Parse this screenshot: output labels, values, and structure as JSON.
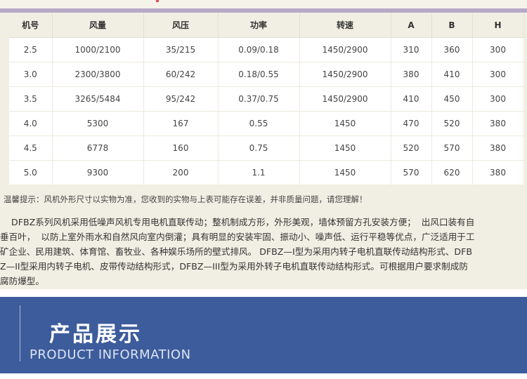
{
  "table": {
    "headers": [
      "机号",
      "风量",
      "风压",
      "功率",
      "转速",
      "A",
      "B",
      "H"
    ],
    "rows": [
      [
        "2.5",
        "1000/2100",
        "35/215",
        "0.09/0.18",
        "1450/2900",
        "310",
        "360",
        "300"
      ],
      [
        "3.0",
        "2300/3800",
        "60/242",
        "0.18/0.55",
        "1450/2900",
        "380",
        "410",
        "300"
      ],
      [
        "3.5",
        "3265/5484",
        "95/242",
        "0.37/0.75",
        "1450/2900",
        "410",
        "450",
        "300"
      ],
      [
        "4.0",
        "5300",
        "167",
        "0.55",
        "1450",
        "470",
        "520",
        "380"
      ],
      [
        "4.5",
        "6778",
        "160",
        "0.75",
        "1450",
        "520",
        "570",
        "380"
      ],
      [
        "5.0",
        "9300",
        "200",
        "1.1",
        "1450",
        "570",
        "620",
        "380"
      ]
    ]
  },
  "notice": "温馨提示：风机外形尺寸以实物为准，您收到的实物与上表可能存在误差，并非质量问题，请您理解！",
  "description_lines": [
    "    DFBZ系列风机采用低噪声风机专用电机直联传动；整机制成方形，外形美观，墙体预留方孔安装方便；  出风口装有自",
    "垂百叶，  以防上室外雨水和自然风向室内倒灌；具有明显的安装牢固、振动小、噪声低、运行平稳等优点，广泛适用于工",
    "矿企业、民用建筑、体育馆、畜牧业、各种娱乐场所的壁式排风。 DFBZ—I型为采用内转子电机直联传动结构形式、DFB",
    "Z—II型采用内转子电机、皮带传动结构形式，DFBZ—III型为采用外转子电机直联传动结构形式。可根据用户要求制成防",
    "腐防爆型。"
  ],
  "banner": {
    "title_cn": "产品展示",
    "title_en": "PRODUCT INFORMATION"
  },
  "colors": {
    "page_background": "#f1efe3",
    "banner": "#3d5c9c",
    "accent_line": "#b8a8c8"
  }
}
